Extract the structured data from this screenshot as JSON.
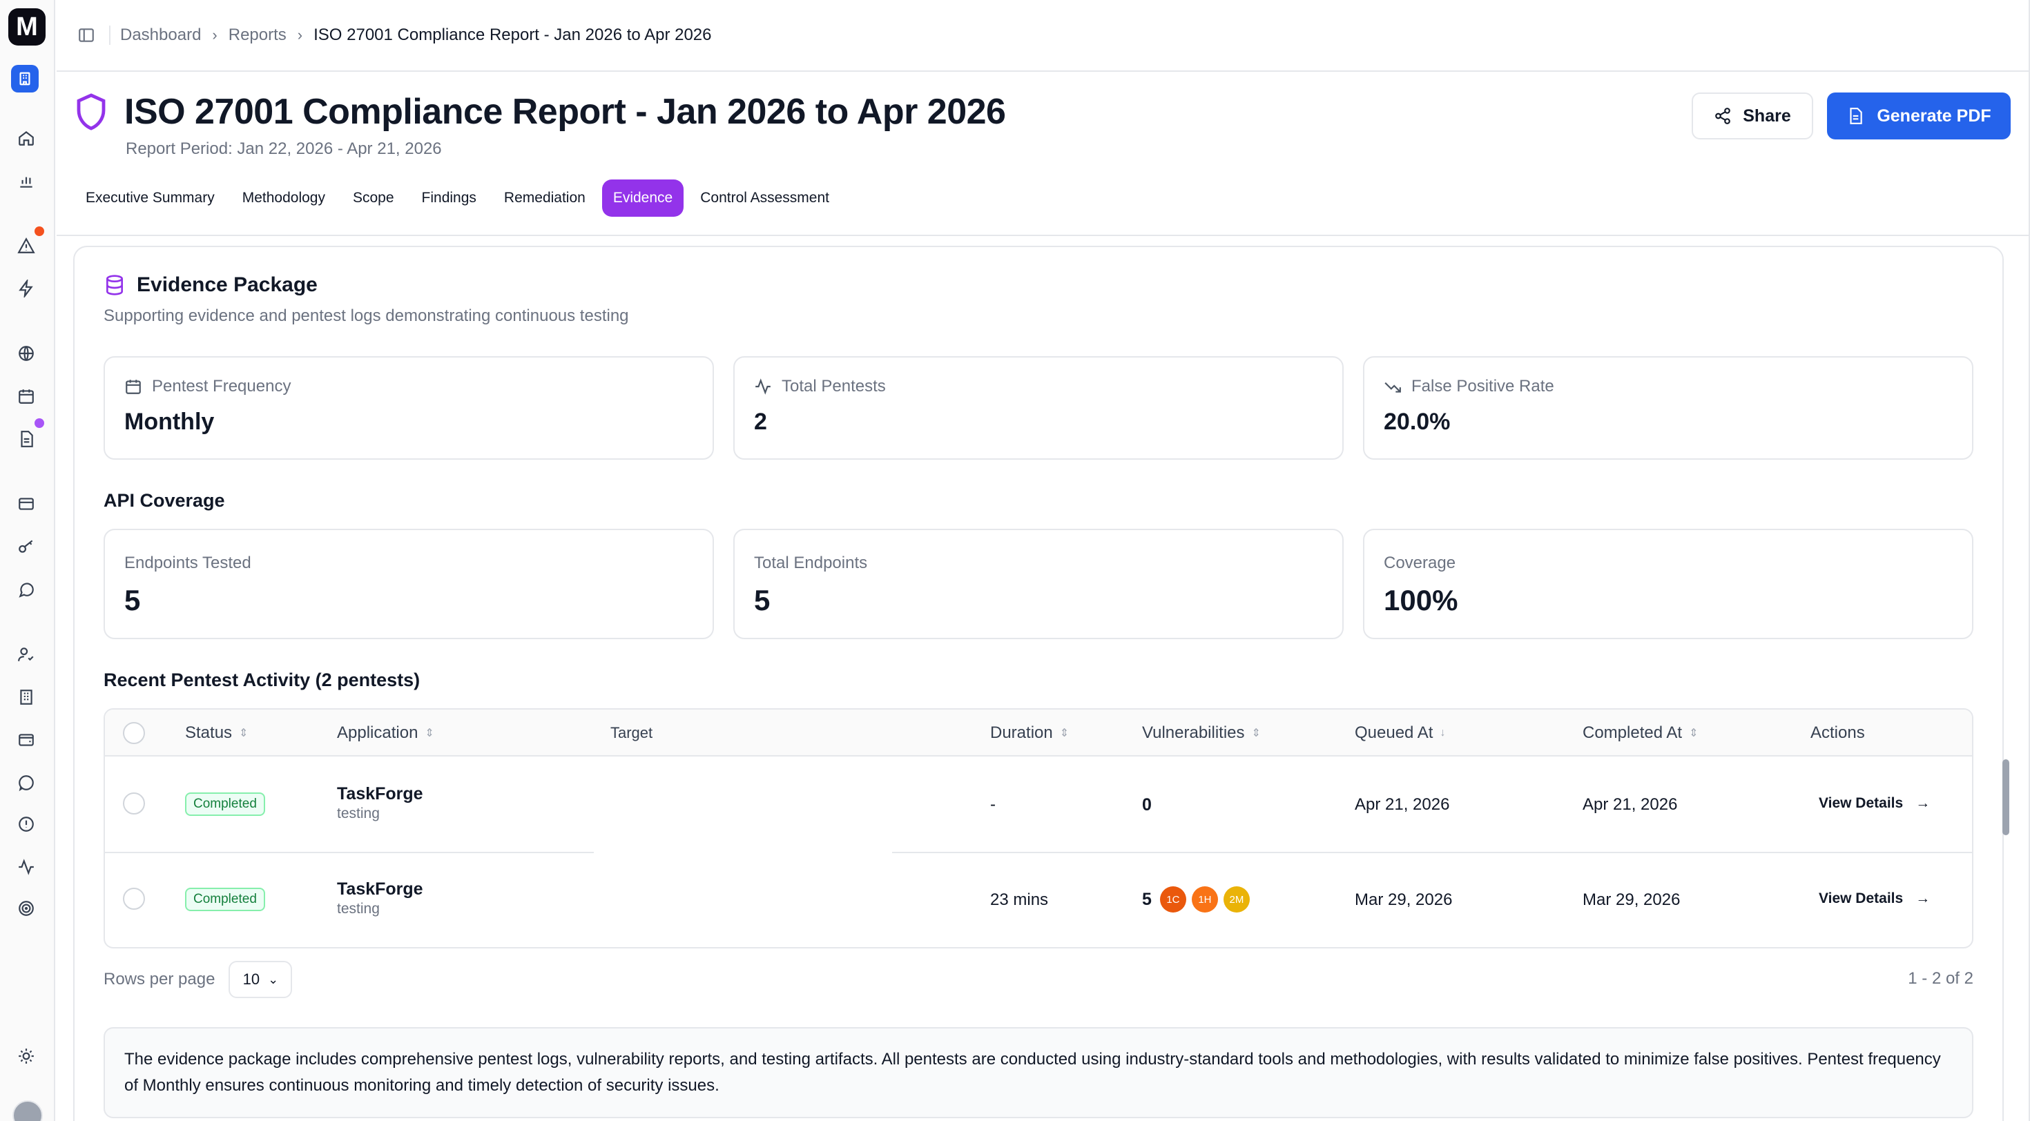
{
  "sidebar": {
    "logo_letter": "M",
    "icons": [
      "home-icon",
      "bar-chart-icon",
      "alert-triangle-icon",
      "zap-icon",
      "globe-icon",
      "calendar-icon",
      "file-text-icon",
      "credit-card-icon",
      "key-icon",
      "message-icon",
      "user-check-icon",
      "building-icon",
      "wallet-icon",
      "chat-icon",
      "alert-circle-icon",
      "activity-icon",
      "target-icon",
      "sun-icon"
    ]
  },
  "breadcrumb": {
    "items": [
      "Dashboard",
      "Reports",
      "ISO 27001 Compliance Report - Jan 2026 to Apr 2026"
    ]
  },
  "header": {
    "title": "ISO 27001 Compliance Report - Jan 2026 to Apr 2026",
    "report_period": "Report Period: Jan 22, 2026 - Apr 21, 2026",
    "share_label": "Share",
    "pdf_label": "Generate PDF"
  },
  "tabs": [
    {
      "label": "Executive Summary",
      "active": false
    },
    {
      "label": "Methodology",
      "active": false
    },
    {
      "label": "Scope",
      "active": false
    },
    {
      "label": "Findings",
      "active": false
    },
    {
      "label": "Remediation",
      "active": false
    },
    {
      "label": "Evidence",
      "active": true
    },
    {
      "label": "Control Assessment",
      "active": false
    }
  ],
  "evidence": {
    "title": "Evidence Package",
    "subtitle": "Supporting evidence and pentest logs demonstrating continuous testing",
    "stats": [
      {
        "label": "Pentest Frequency",
        "value": "Monthly"
      },
      {
        "label": "Total Pentests",
        "value": "2"
      },
      {
        "label": "False Positive Rate",
        "value": "20.0%"
      }
    ]
  },
  "api_coverage": {
    "title": "API Coverage",
    "stats": [
      {
        "label": "Endpoints Tested",
        "value": "5"
      },
      {
        "label": "Total Endpoints",
        "value": "5"
      },
      {
        "label": "Coverage",
        "value": "100%"
      }
    ]
  },
  "activity": {
    "title": "Recent Pentest Activity (2 pentests)",
    "columns": [
      "Status",
      "Application",
      "Target",
      "Duration",
      "Vulnerabilities",
      "Queued At",
      "Completed At",
      "Actions"
    ],
    "rows": [
      {
        "status": "Completed",
        "app": "TaskForge",
        "env": "testing",
        "target": "",
        "duration": "-",
        "vuln_total": "0",
        "chips": [],
        "queued": "Apr 21, 2026",
        "completed": "Apr 21, 2026",
        "action": "View Details"
      },
      {
        "status": "Completed",
        "app": "TaskForge",
        "env": "testing",
        "target": "",
        "duration": "23 mins",
        "vuln_total": "5",
        "chips": [
          {
            "text": "1C",
            "color": "#ea580c"
          },
          {
            "text": "1H",
            "color": "#f97316"
          },
          {
            "text": "2M",
            "color": "#eab308"
          }
        ],
        "queued": "Mar 29, 2026",
        "completed": "Mar 29, 2026",
        "action": "View Details"
      }
    ],
    "rows_per_page_label": "Rows per page",
    "rows_per_page": "10",
    "pagination": "1 - 2 of 2"
  },
  "note": "The evidence package includes comprehensive pentest logs, vulnerability reports, and testing artifacts. All pentests are conducted using industry-standard tools and methodologies, with results validated to minimize false positives. Pentest frequency of Monthly ensures continuous monitoring and timely detection of security issues.",
  "colors": {
    "accent": "#9333ea",
    "primary": "#2563eb",
    "success": "#15803d",
    "alert_dot": "#f4511e",
    "doc_dot": "#a855f7"
  }
}
